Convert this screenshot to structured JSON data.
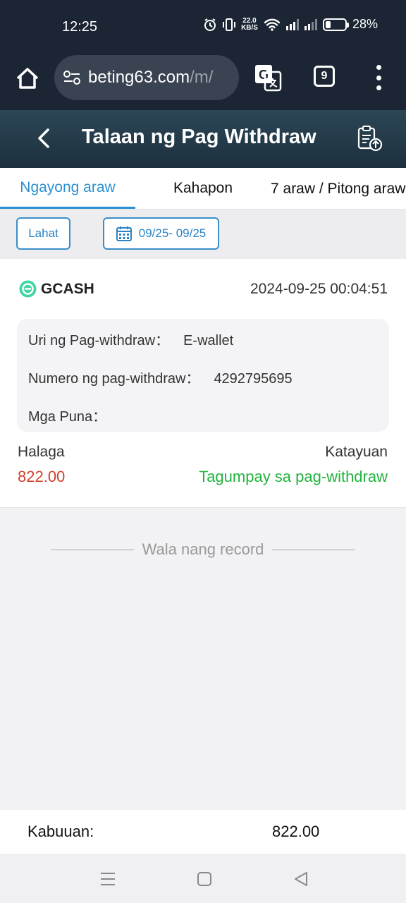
{
  "status_bar": {
    "time": "12:25",
    "net_speed_value": "22.0",
    "net_speed_unit": "KB/S",
    "battery_percent": "28%",
    "battery_level": 0.28
  },
  "browser": {
    "url_host": "beting63.com",
    "url_path": "/m/",
    "tab_count": "9"
  },
  "header": {
    "title": "Talaan ng Pag Withdraw"
  },
  "tabs": [
    {
      "label": "Ngayong araw",
      "active": true
    },
    {
      "label": "Kahapon",
      "active": false
    },
    {
      "label": "7 araw / Pitong araw",
      "active": false
    }
  ],
  "filters": {
    "all_label": "Lahat",
    "date_range": "09/25- 09/25"
  },
  "record": {
    "method": "GCASH",
    "datetime": "2024-09-25 00:04:51",
    "type_label": "Uri ng Pag-withdraw：",
    "type_value": "E-wallet",
    "number_label": "Numero ng pag-withdraw：",
    "number_value": "4292795695",
    "remarks_label": "Mga Puna：",
    "remarks_value": "",
    "amount_label": "Halaga",
    "amount_value": "822.00",
    "status_label": "Katayuan",
    "status_value": "Tagumpay sa pag-withdraw"
  },
  "no_more_text": "Wala nang record",
  "total": {
    "label": "Kabuuan:",
    "value": "822.00"
  },
  "colors": {
    "accent": "#2a8fd0",
    "amount": "#d4402a",
    "success": "#22b33e",
    "header_bg": "#1c303e"
  },
  "icons": [
    "home-icon",
    "site-settings-icon",
    "translate-icon",
    "tab-switcher-icon",
    "more-menu-icon",
    "back-arrow-icon",
    "upload-record-icon",
    "calendar-icon",
    "gcash-icon",
    "nav-menu-icon",
    "nav-home-icon",
    "nav-back-icon"
  ]
}
